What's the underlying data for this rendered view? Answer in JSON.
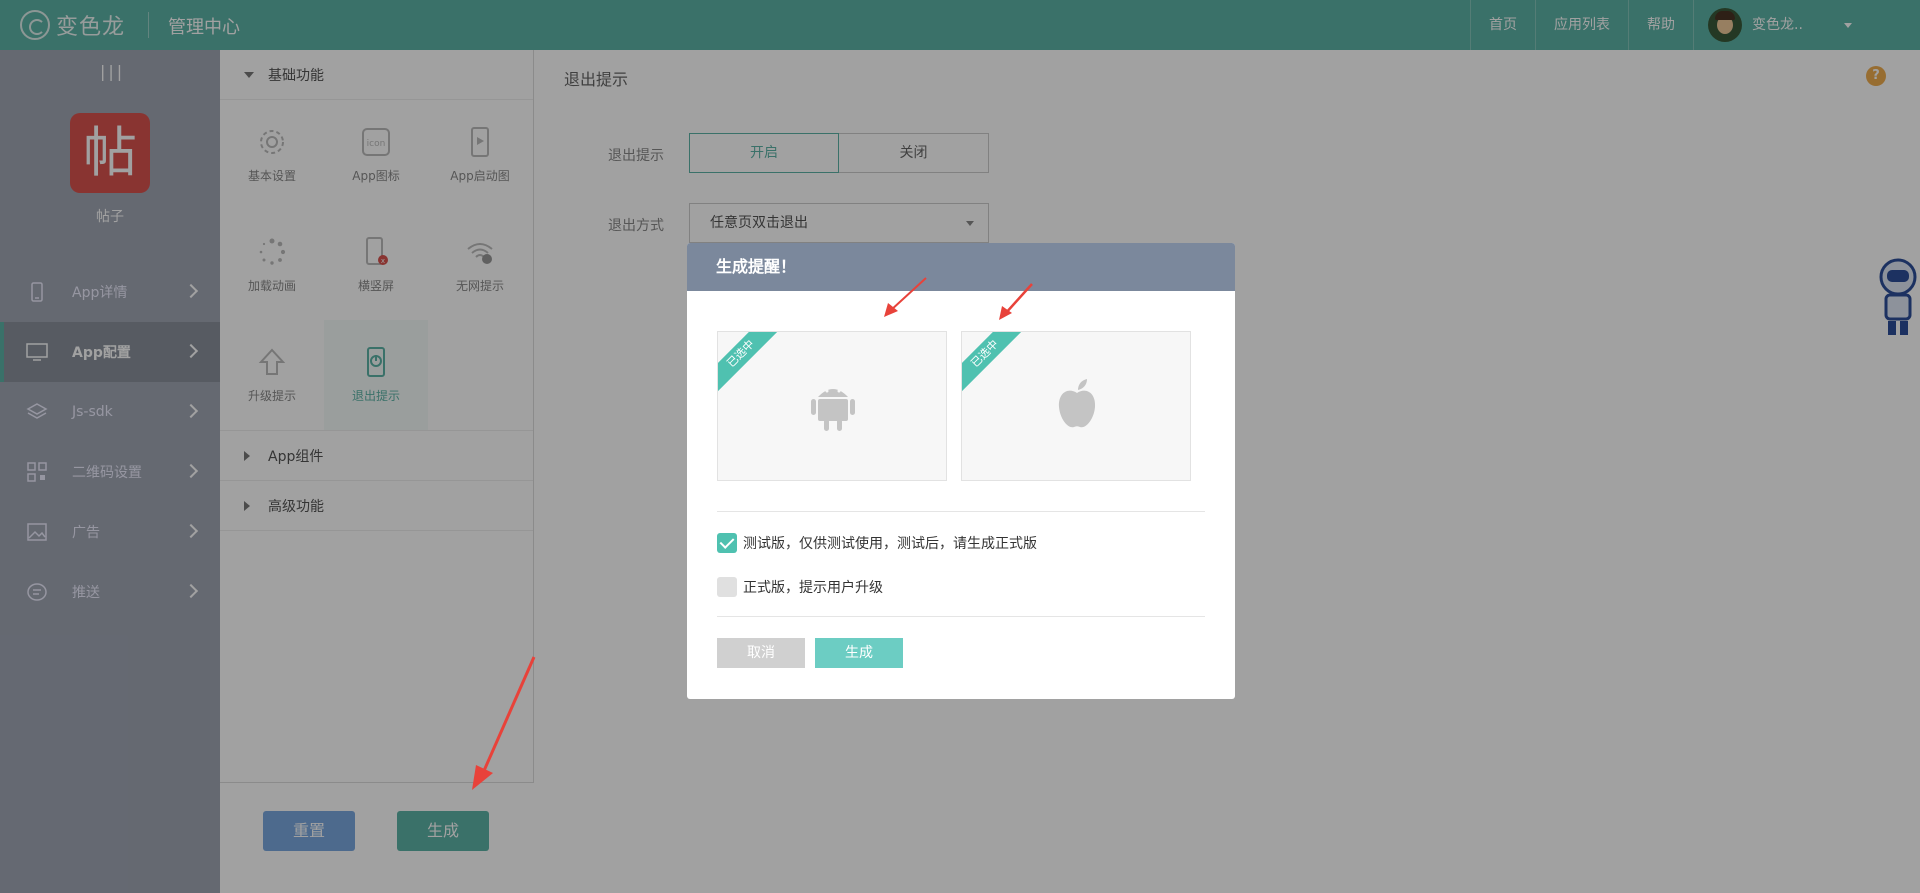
{
  "header": {
    "logo_text": "变色龙",
    "admin_title": "管理中心",
    "nav": [
      "首页",
      "应用列表",
      "帮助"
    ],
    "username": "变色龙.."
  },
  "sidebar": {
    "toggle_glyph": "|||",
    "app_icon_char": "帖",
    "app_name": "帖子",
    "items": [
      {
        "label": "App详情",
        "active": false
      },
      {
        "label": "App配置",
        "active": true
      },
      {
        "label": "Js-sdk",
        "active": false
      },
      {
        "label": "二维码设置",
        "active": false
      },
      {
        "label": "广告",
        "active": false
      },
      {
        "label": "推送",
        "active": false
      }
    ]
  },
  "panel": {
    "group_basic": "基础功能",
    "functions": [
      {
        "label": "基本设置",
        "icon": "gear-icon"
      },
      {
        "label": "App图标",
        "icon": "app-icon-icon"
      },
      {
        "label": "App启动图",
        "icon": "launch-image-icon"
      },
      {
        "label": "加载动画",
        "icon": "loading-icon"
      },
      {
        "label": "横竖屏",
        "icon": "rotate-screen-icon"
      },
      {
        "label": "无网提示",
        "icon": "no-network-icon"
      },
      {
        "label": "升级提示",
        "icon": "upgrade-icon"
      },
      {
        "label": "退出提示",
        "icon": "exit-icon"
      }
    ],
    "group_components": "App组件",
    "group_advanced": "高级功能",
    "reset_label": "重置",
    "generate_label": "生成"
  },
  "content": {
    "page_title": "退出提示",
    "help": "?",
    "exit_prompt_label": "退出提示",
    "on_label": "开启",
    "off_label": "关闭",
    "exit_mode_label": "退出方式",
    "exit_mode_value": "任意页双击退出"
  },
  "modal": {
    "title": "生成提醒！",
    "platforms": [
      {
        "name": "android",
        "badge": "已选中"
      },
      {
        "name": "ios",
        "badge": "已选中"
      }
    ],
    "option_test": "测试版，仅供测试使用，测试后，请生成正式版",
    "option_test_checked": true,
    "option_release": "正式版，提示用户升级",
    "option_release_checked": false,
    "cancel_label": "取消",
    "generate_label": "生成"
  },
  "colors": {
    "primary": "#5db3a6",
    "header_bg": "#7b889c",
    "arrow": "#e8423a"
  }
}
